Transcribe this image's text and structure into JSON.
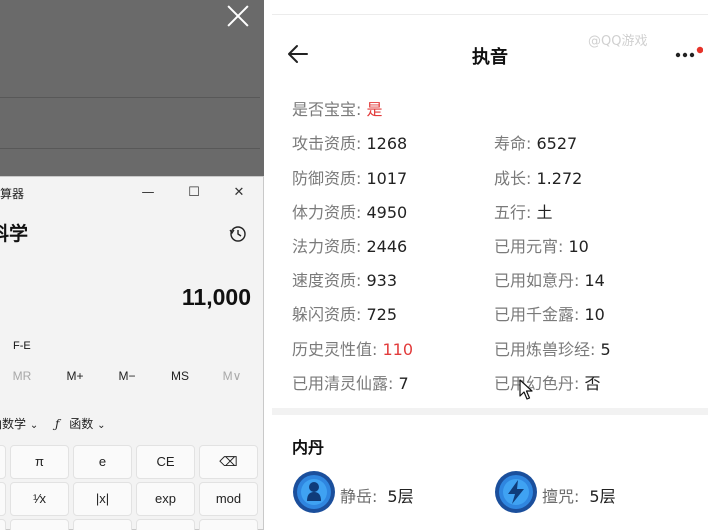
{
  "background_app": {
    "close_label": "✕"
  },
  "calculator": {
    "title": "计算器",
    "mode": "科学",
    "display": "11,000",
    "fe_label": "F-E",
    "memory": [
      "MR",
      "M+",
      "M−",
      "MS",
      "M∨"
    ],
    "function_row": {
      "trig_label": "函数学",
      "func_label": "函数"
    },
    "keys_row1": [
      "π",
      "e",
      "CE",
      "⌫"
    ],
    "keys_row2": [
      "¹⁄x",
      "|x|",
      "exp",
      "mod"
    ],
    "window_controls": {
      "minimize": "—",
      "maximize": "☐",
      "close": "✕"
    }
  },
  "panel": {
    "title": "执音",
    "watermark": "@QQ游戏",
    "is_baby": {
      "label": "是否宝宝:",
      "value": "是"
    },
    "stats_left": [
      {
        "label": "攻击资质:",
        "value": "1268"
      },
      {
        "label": "防御资质:",
        "value": "1017"
      },
      {
        "label": "体力资质:",
        "value": "4950"
      },
      {
        "label": "法力资质:",
        "value": "2446"
      },
      {
        "label": "速度资质:",
        "value": "933"
      },
      {
        "label": "躲闪资质:",
        "value": "725"
      },
      {
        "label": "历史灵性值:",
        "value": "110"
      },
      {
        "label": "已用清灵仙露:",
        "value": "7"
      }
    ],
    "stats_right": [
      {
        "label": "寿命:",
        "value": "6527"
      },
      {
        "label": "成长:",
        "value": "1.272"
      },
      {
        "label": "五行:",
        "value": "土"
      },
      {
        "label": "已用元宵:",
        "value": "10"
      },
      {
        "label": "已用如意丹:",
        "value": "14"
      },
      {
        "label": "已用千金露:",
        "value": "10"
      },
      {
        "label": "已用炼兽珍经:",
        "value": "5"
      },
      {
        "label": "已用幻色丹:",
        "value": "否"
      }
    ],
    "inner_dan": {
      "title": "内丹",
      "skills": [
        {
          "name": "静岳:",
          "level": "5层"
        },
        {
          "name": "擅咒:",
          "level": "5层"
        }
      ]
    }
  }
}
